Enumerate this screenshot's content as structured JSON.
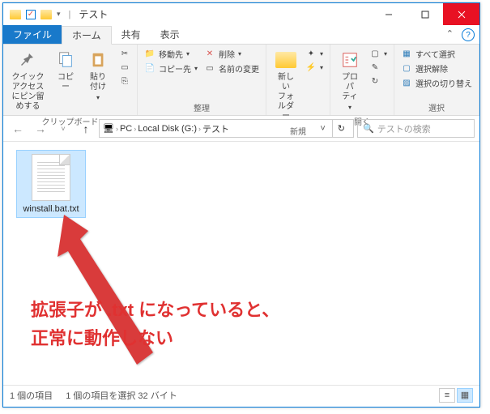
{
  "window": {
    "title": "テスト"
  },
  "ribbonTabs": {
    "file": "ファイル",
    "home": "ホーム",
    "share": "共有",
    "view": "表示"
  },
  "ribbon": {
    "clipboard": {
      "label": "クリップボード",
      "pin": "クイック アクセス\nにピン留めする",
      "copy": "コピー",
      "paste": "貼り付け"
    },
    "organize": {
      "label": "整理",
      "moveTo": "移動先",
      "delete": "削除",
      "copyTo": "コピー先",
      "rename": "名前の変更"
    },
    "new": {
      "label": "新規",
      "newFolder": "新しい\nフォルダー"
    },
    "open": {
      "label": "開く",
      "properties": "プロパ\nティ"
    },
    "select": {
      "label": "選択",
      "selectAll": "すべて選択",
      "selectNone": "選択解除",
      "invert": "選択の切り替え"
    }
  },
  "breadcrumb": {
    "pc": "PC",
    "drive": "Local Disk (G:)",
    "folder": "テスト"
  },
  "search": {
    "placeholder": "テストの検索"
  },
  "file": {
    "name": "winstall.bat.txt"
  },
  "annotation": {
    "line1": "拡張子が .txt になっていると、",
    "line2": "正常に動作しない"
  },
  "status": {
    "count": "1 個の項目",
    "selected": "1 個の項目を選択 32 バイト"
  }
}
